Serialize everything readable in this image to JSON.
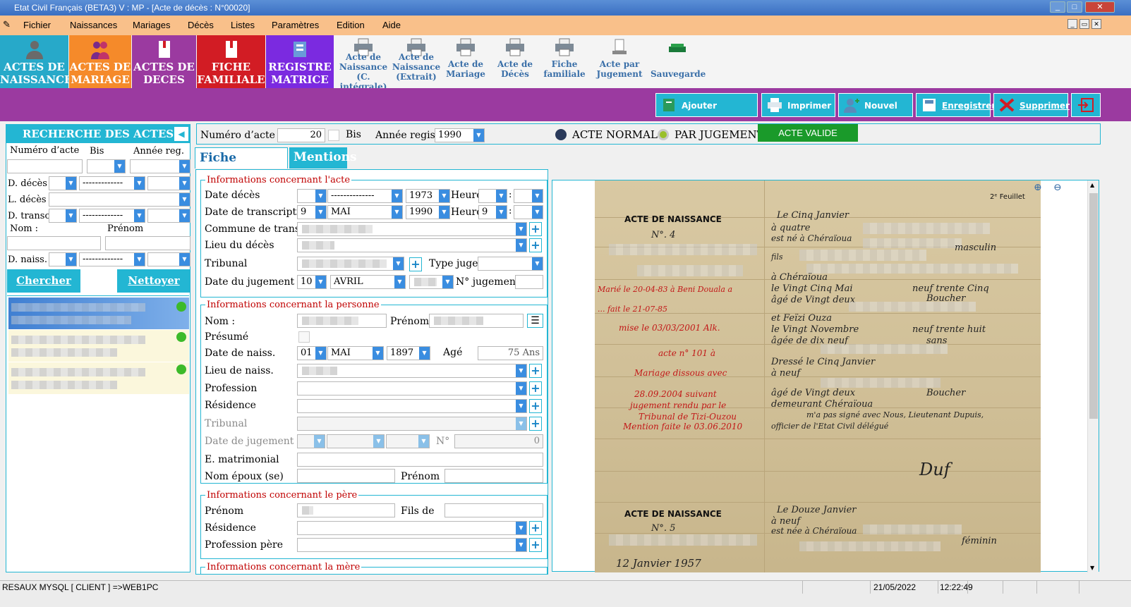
{
  "window": {
    "title": "Etat Civil Français (BETA3)  V : MP  - [Acte de décès  : N°00020]"
  },
  "menu": [
    "Fichier",
    "Naissances",
    "Mariages",
    "Décès",
    "Listes",
    "Paramètres",
    "Edition",
    "Aide"
  ],
  "ribbon": {
    "tiles": [
      {
        "l1": "ACTES DE",
        "l2": "NAISSANCE",
        "color": "#27a9c9"
      },
      {
        "l1": "ACTES DE",
        "l2": "MARIAGE",
        "color": "#f58a2a"
      },
      {
        "l1": "ACTES DE",
        "l2": "DECES",
        "color": "#9b3aa0"
      },
      {
        "l1": "FICHE",
        "l2": "FAMILIALE",
        "color": "#d21c24"
      },
      {
        "l1": "REGISTRE",
        "l2": "MATRICE",
        "color": "#7b2ae0"
      }
    ],
    "buttons": [
      {
        "l1": "Acte de",
        "l2": "Naissance",
        "l3": "(C. intégrale)"
      },
      {
        "l1": "Acte de",
        "l2": "Naissance",
        "l3": "(Extrait)"
      },
      {
        "l1": "",
        "l2": "Acte de",
        "l3": "Mariage"
      },
      {
        "l1": "",
        "l2": "Acte de",
        "l3": "Décès"
      },
      {
        "l1": "",
        "l2": "Fiche",
        "l3": "familiale"
      },
      {
        "l1": "",
        "l2": "Acte par",
        "l3": "Jugement"
      },
      {
        "l1": "",
        "l2": "",
        "l3": "Sauvegarde"
      }
    ]
  },
  "toolbar": {
    "add_doc": "Ajouter document",
    "print": "Imprimer",
    "new_act": "Nouvel Acte",
    "save": "Enregistrer",
    "delete": "Supprimer"
  },
  "search": {
    "header": "RECHERCHE DES ACTES",
    "num_label": "Numéro d’acte",
    "bis_label": "Bis",
    "year_label": "Année reg.",
    "death_date_label": "D. décès",
    "death_place_label": "L. décès",
    "transc_label": "D. transc.",
    "name_label": "Nom :",
    "firstname_label": "Prénom",
    "birth_label": "D. naiss.",
    "dash_value": "-------------",
    "search_btn": "Chercher",
    "clear_btn": "Nettoyer"
  },
  "act_header": {
    "num_label": "Numéro d’acte",
    "num_value": "20",
    "bis_label": "Bis",
    "year_label": "Année regis",
    "year_value": "1990",
    "normal_label": "ACTE NORMAL",
    "judgement_label": "PAR JUGEMENT",
    "status": "ACTE VALIDE"
  },
  "tabs": [
    "Fiche détaillée",
    "Mentions"
  ],
  "acte": {
    "title": "Informations concernant l'acte",
    "date_deces": "Date décès",
    "dash_value": "--------------",
    "deces_year": "1973",
    "heure": "Heure",
    "date_transc": "Date de transcription",
    "transc_day": "9",
    "transc_month": "MAI",
    "transc_year": "1990",
    "transc_hour": "9",
    "commune": "Commune de transc.",
    "lieu": "Lieu du décès",
    "tribunal": "Tribunal",
    "type_juge": "Type juge.",
    "date_jugement": "Date du jugement",
    "jug_day": "10",
    "jug_month": "AVRIL",
    "num_jugement": "N° jugement"
  },
  "personne": {
    "title": "Informations concernant la personne",
    "nom": "Nom :",
    "prenom": "Prénom",
    "presume": "Présumé",
    "date_naiss": "Date de naiss.",
    "naiss_day": "01",
    "naiss_month": "MAI",
    "naiss_year": "1897",
    "age_label": "Agé",
    "age_value": "75 Ans",
    "lieu_naiss": "Lieu de naiss.",
    "profession": "Profession",
    "residence": "Résidence",
    "tribunal": "Tribunal",
    "date_jugement": "Date de jugement",
    "no": "N°",
    "no_value": "0",
    "matrimonial": "E. matrimonial",
    "nom_epoux": "Nom époux (se)",
    "prenom2": "Prénom"
  },
  "pere": {
    "title": "Informations concernant le père",
    "prenom": "Prénom",
    "fils_de": "Fils de",
    "residence": "Résidence",
    "profession": "Profession père"
  },
  "mere": {
    "title": "Informations concernant la mère"
  },
  "document": {
    "feuillet": "2ᵉ Feuillet",
    "h1": "ACTE  DE  NAISSANCE",
    "n1": "N°. 4",
    "h2": "ACTE  DE  NAISSANCE",
    "n2": "N°. 5",
    "l1": "Le   Cinq  Janvier",
    "l2": "à   quatre",
    "l3": "est né à   Chéraïoua",
    "l4": "fils",
    "l5": "à   Chéraïoua",
    "l6": "le   Vingt Cinq  Mai",
    "l7": "âgé de   Vingt deux",
    "l8": "et   Feïzi  Ouza",
    "l9": "le   Vingt Novembre",
    "l10": "âgée de   dix neuf",
    "l11": "Dressé le   Cinq  Janvier",
    "l12": "à   neuf",
    "l13": "âgé de   Vingt deux",
    "l14": "demeurant   Chéraïoua",
    "l15": "m'a pas signé avec Nous, Lieutenant Dupuis,",
    "l16": "officier de l'Etat Civil délégué",
    "sex1": "masculin",
    "prof1": "Boucher",
    "prof2": "Boucher",
    "sans": "sans",
    "neuf1": "neuf  trente Cinq",
    "neuf2": "neuf  trente huit",
    "sig": "Duf",
    "m1": "Le   Douze  Janvier",
    "m2": "à   neuf",
    "m3": "est née à   Chéraïoua",
    "m4": "féminin",
    "m5": "12 Janvier 1957",
    "r1": "Marié le 20-04-83 à Beni Douala a",
    "r2": "...  fait le 21-07-85",
    "r3": "mise le 03/03/2001 Alk.",
    "r4": "acte n° 101  à",
    "r5": "Mariage dissous avec",
    "r6": "28.09.2004 suivant",
    "r7": "jugement rendu par le",
    "r8": "Tribunal de Tizi-Ouzou",
    "r9": "Mention faite le 03.06.2010"
  },
  "status": {
    "network": "RESAUX MYSQL [ CLIENT ] =>WEB1PC",
    "date": "21/05/2022",
    "time": "12:22:49"
  }
}
